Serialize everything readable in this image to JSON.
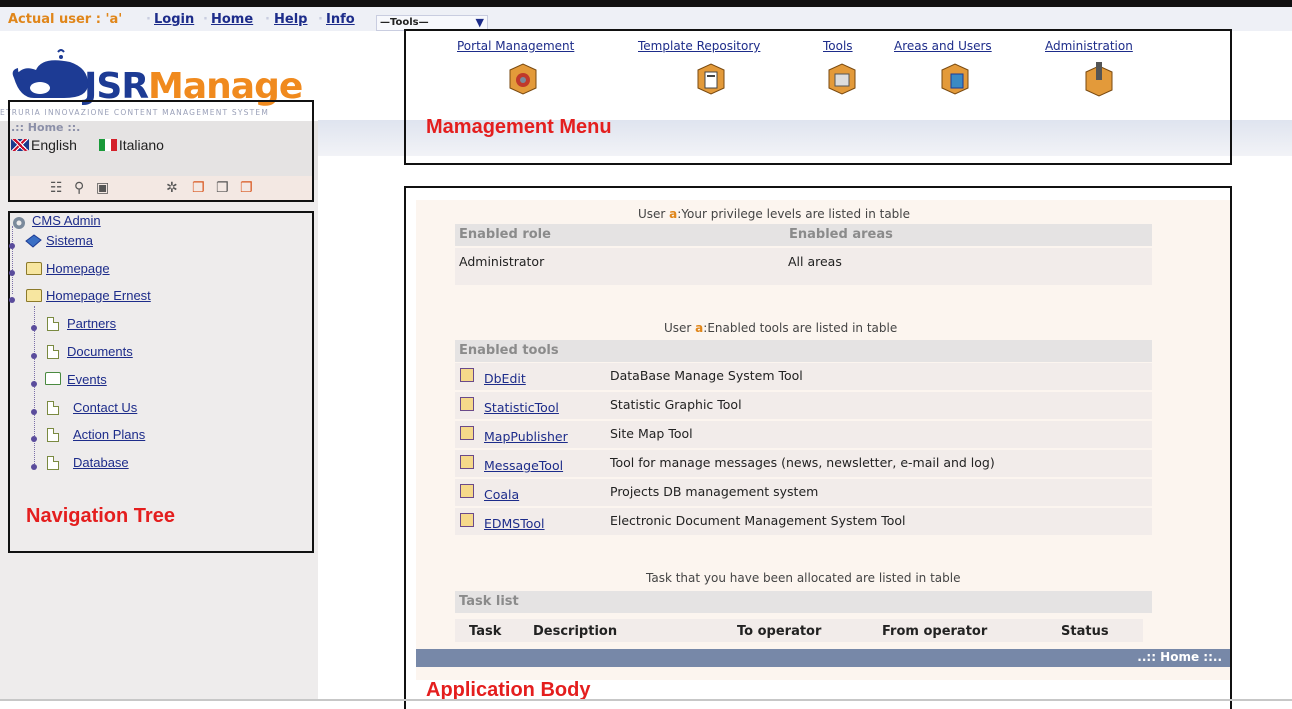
{
  "topbar": {
    "actual_user": "Actual user : 'a'",
    "links": [
      "Login",
      "Home",
      "Help",
      "Info"
    ],
    "tools_select": "—Tools—"
  },
  "logo": {
    "jsr": "JSR",
    "manage": "Manage",
    "tagline": "ETRURIA INNOVAZIONE CONTENT MANAGEMENT SYSTEM"
  },
  "home_panel": {
    "home_label": ".:: Home ::.",
    "languages": [
      "English",
      "Italiano"
    ]
  },
  "management_menu": {
    "items": [
      "Portal Management",
      "Template Repository",
      "Tools",
      "Areas and Users",
      "Administration"
    ],
    "caption": "Mamagement Menu"
  },
  "nav_tree": {
    "root": "CMS Admin",
    "items": [
      "Sistema",
      "Homepage",
      "Homepage Ernest",
      "Partners",
      "Documents",
      "Events",
      "Contact Us",
      "Action Plans",
      "Database"
    ],
    "caption": "Navigation Tree"
  },
  "app_body": {
    "privilege_caption_pre": "User ",
    "user_name": "a",
    "privilege_caption_post": ":Your privilege levels are listed in table",
    "role_headers": [
      "Enabled role",
      "Enabled areas"
    ],
    "role_row": [
      "Administrator",
      "All areas"
    ],
    "tools_caption_post": ":Enabled tools are listed in table",
    "tools_header": "Enabled tools",
    "tools": [
      {
        "name": "DbEdit",
        "desc": "DataBase Manage System Tool"
      },
      {
        "name": "StatisticTool",
        "desc": "Statistic Graphic Tool"
      },
      {
        "name": "MapPublisher",
        "desc": "Site Map Tool"
      },
      {
        "name": "MessageTool",
        "desc": "Tool for manage messages (news, newsletter, e-mail and log)"
      },
      {
        "name": "Coala",
        "desc": "Projects DB management system"
      },
      {
        "name": "EDMSTool",
        "desc": "Electronic Document Management System Tool"
      }
    ],
    "task_caption": "Task that you have been allocated are listed in table",
    "task_header": "Task list",
    "task_columns": [
      "Task",
      "Description",
      "To operator",
      "From operator",
      "Status"
    ],
    "footer_home": "..:: Home ::..",
    "caption": "Application Body"
  }
}
